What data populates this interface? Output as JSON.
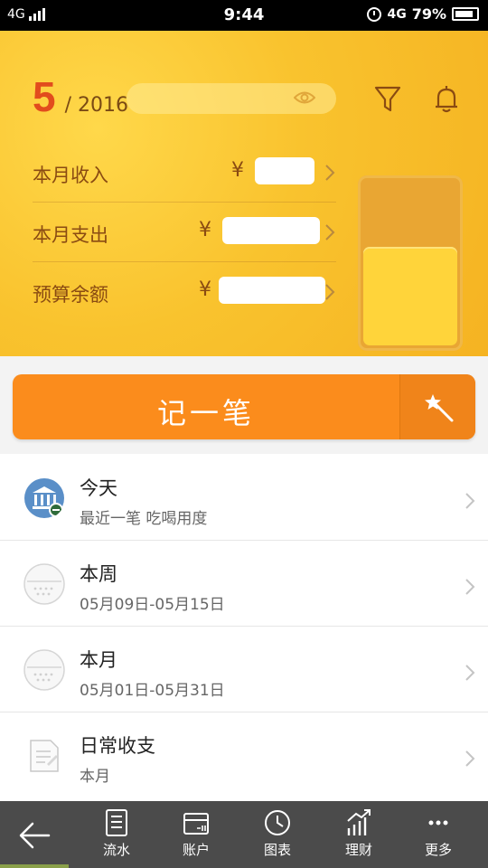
{
  "status_bar": {
    "network_left": "4G",
    "time": "9:44",
    "network_right": "4G",
    "battery": "79%"
  },
  "header": {
    "month": "5",
    "year": "/ 2016",
    "rows": [
      {
        "label": "本月收入",
        "currency": "¥"
      },
      {
        "label": "本月支出",
        "currency": "¥"
      },
      {
        "label": "预算余额",
        "currency": "¥"
      }
    ],
    "budget_remaining_fraction": 0.6
  },
  "record_button": {
    "label": "记一笔"
  },
  "list": [
    {
      "title": "今天",
      "subtitle": "最近一笔 吃喝用度",
      "icon": "bank-icon"
    },
    {
      "title": "本周",
      "subtitle": "05月09日-05月15日",
      "icon": "calendar-icon"
    },
    {
      "title": "本月",
      "subtitle": "05月01日-05月31日",
      "icon": "calendar-icon"
    },
    {
      "title": "日常收支",
      "subtitle": "本月",
      "icon": "document-icon"
    }
  ],
  "bottom_nav": {
    "items": [
      {
        "label": "流水",
        "icon": "ledger-icon"
      },
      {
        "label": "账户",
        "icon": "wallet-icon"
      },
      {
        "label": "图表",
        "icon": "clock-chart-icon"
      },
      {
        "label": "理财",
        "icon": "trend-icon"
      },
      {
        "label": "更多",
        "icon": "more-icon"
      }
    ]
  },
  "colors": {
    "header_bg": "#f9c32e",
    "accent_orange": "#fb8c1c",
    "month_red": "#e24c1d",
    "nav_bg": "#4b4b4b"
  }
}
